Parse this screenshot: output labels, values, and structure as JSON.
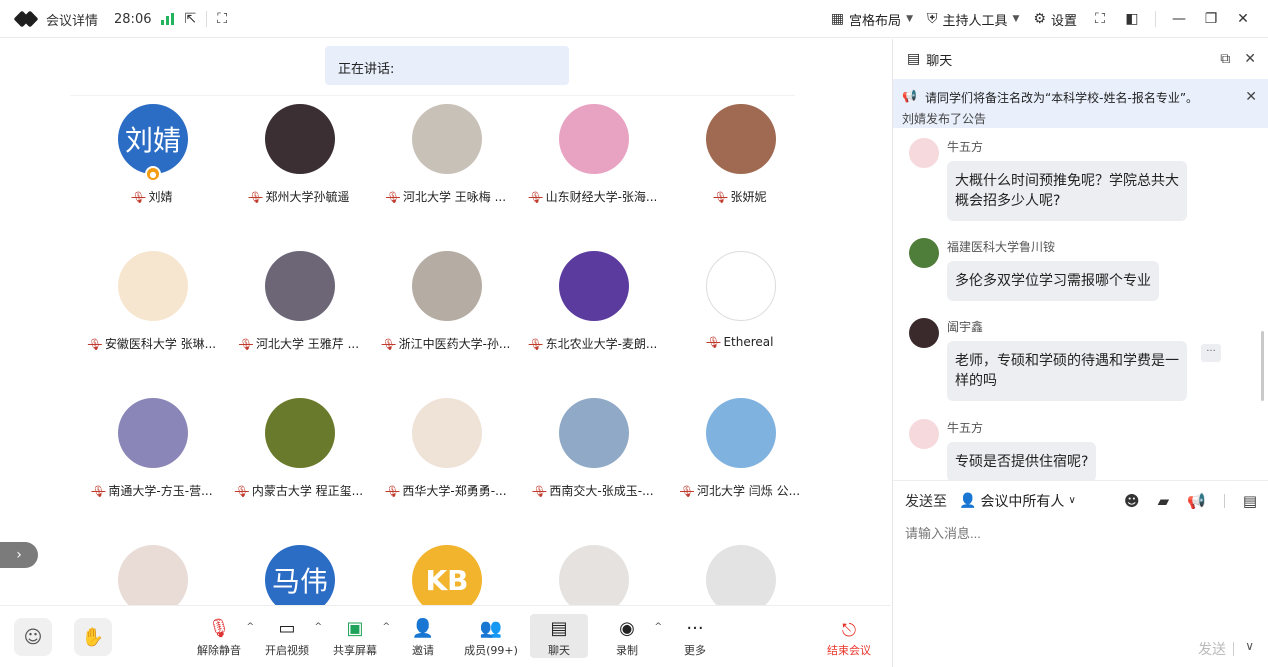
{
  "topbar": {
    "title": "会议详情",
    "elapsed": "28:06",
    "layout_label": "宫格布局",
    "host_tools_label": "主持人工具",
    "settings_label": "设置"
  },
  "speaking": "正在讲话:",
  "participants": [
    {
      "name": "刘婧",
      "avatar_text": "刘婧",
      "avatar_color": "#2b6cc4",
      "host": true
    },
    {
      "name": "郑州大学孙毓遥",
      "avatar_color": "#3b2f33"
    },
    {
      "name": "河北大学 王咏梅 ...",
      "avatar_color": "#c8c1b8"
    },
    {
      "name": "山东财经大学-张海...",
      "avatar_color": "#e9a3c2"
    },
    {
      "name": "张妍妮",
      "avatar_color": "#a06a52"
    },
    {
      "name": "安徽医科大学 张琳...",
      "avatar_color": "#f7e6cf"
    },
    {
      "name": "河北大学 王雅芹 ...",
      "avatar_color": "#6c6677"
    },
    {
      "name": "浙江中医药大学-孙...",
      "avatar_color": "#b5aca4"
    },
    {
      "name": "东北农业大学-麦朗...",
      "avatar_color": "#5b3c9e"
    },
    {
      "name": "Ethereal",
      "avatar_color": "#ffffff"
    },
    {
      "name": "南通大学-方玉-营...",
      "avatar_color": "#8b86b8"
    },
    {
      "name": "内蒙古大学 程正玺...",
      "avatar_color": "#6a7a2c"
    },
    {
      "name": "西华大学-郑勇勇-...",
      "avatar_color": "#efe3d8"
    },
    {
      "name": "西南交大-张成玉-...",
      "avatar_color": "#8fa9c6"
    },
    {
      "name": "河北大学 闫烁 公...",
      "avatar_color": "#7fb2de"
    },
    {
      "name": "",
      "avatar_color": "#e9dcd6"
    },
    {
      "name": "",
      "avatar_text": "马伟",
      "avatar_color": "#2b6cc4"
    },
    {
      "name": "",
      "avatar_text": "KB",
      "avatar_color": "#f2b32d"
    },
    {
      "name": "",
      "avatar_color": "#e5e2df"
    },
    {
      "name": "",
      "avatar_color": "#e3e3e3"
    }
  ],
  "toolbar": {
    "unmute": "解除静音",
    "video": "开启视频",
    "share": "共享屏幕",
    "invite": "邀请",
    "members": "成员(99+)",
    "chat": "聊天",
    "record": "录制",
    "more": "更多",
    "end": "结束会议"
  },
  "chat": {
    "title": "聊天",
    "notice": "请同学们将备注名改为“本科学校-姓名-报名专业”。",
    "notice_by": "刘婧发布了公告",
    "messages": [
      {
        "sender": "牛五方",
        "text_lines": [
          "大概什么时间预推免呢？学院总共大",
          "概会招多少人呢?"
        ],
        "avatar_color": "#f6d9dc"
      },
      {
        "sender": "福建医科大学鲁川铵",
        "text_lines": [
          "多伦多双学位学习需报哪个专业"
        ],
        "avatar_color": "#4f7d3a"
      },
      {
        "sender": "阖宇鑫",
        "text_lines": [
          "老师，专硕和学硕的待遇和学费是一",
          "样的吗"
        ],
        "avatar_color": "#3a2a2c"
      },
      {
        "sender": "牛五方",
        "text_lines": [
          "专硕是否提供住宿呢?"
        ],
        "avatar_color": "#f6d9dc"
      }
    ],
    "send_to_label": "发送至",
    "send_to_value": "会议中所有人",
    "input_placeholder": "请输入消息...",
    "send_label": "发送"
  }
}
